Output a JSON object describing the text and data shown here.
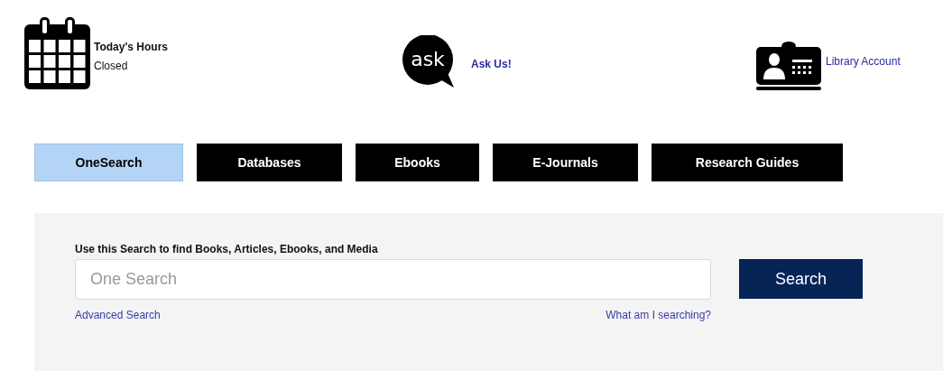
{
  "header": [
    {
      "kind": "hours",
      "title": "Today's Hours",
      "text": "Closed"
    },
    {
      "kind": "ask",
      "icon_text": "ask",
      "link": "Ask Us!"
    },
    {
      "kind": "account",
      "link": "Library Account"
    }
  ],
  "tabs": [
    {
      "label": "OneSearch",
      "selected": true
    },
    {
      "label": "Databases",
      "selected": false
    },
    {
      "label": "Ebooks",
      "selected": false
    },
    {
      "label": "E-Journals",
      "selected": false
    },
    {
      "label": "Research Guides",
      "selected": false
    }
  ],
  "search": {
    "label": "Use this Search to find Books, Articles, Ebooks, and Media",
    "placeholder": "One Search",
    "button": "Search",
    "links": [
      "Advanced Search",
      "What am I searching?"
    ]
  }
}
